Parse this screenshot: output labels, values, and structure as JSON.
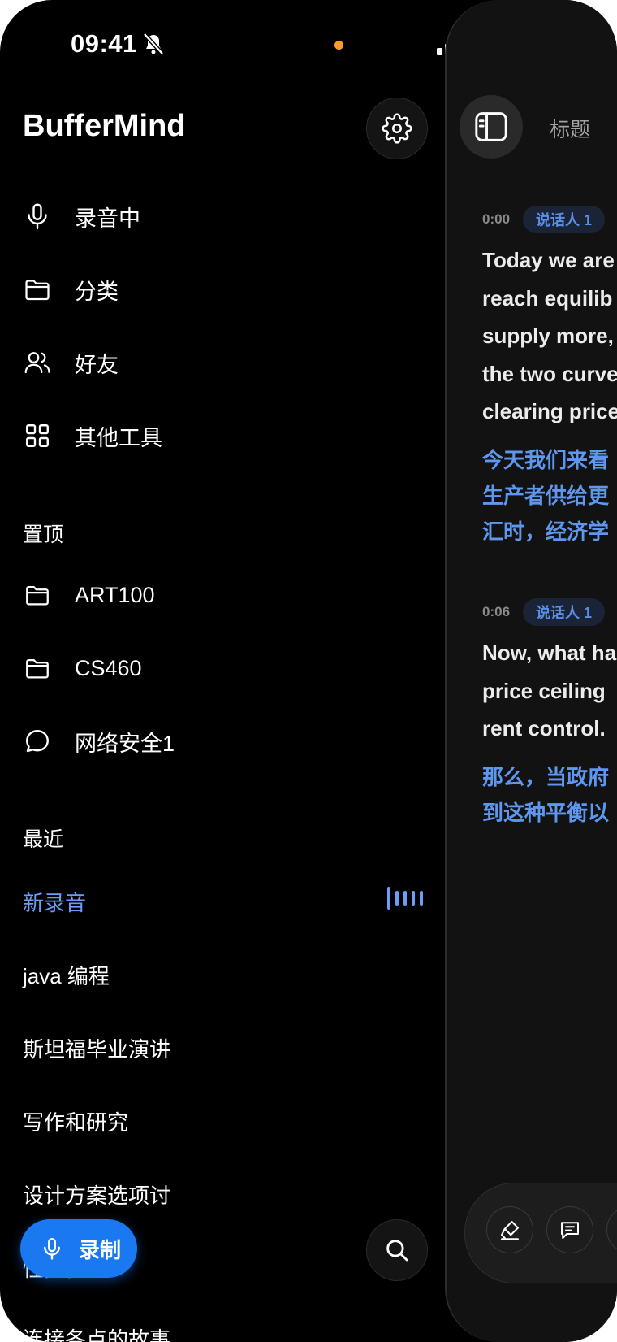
{
  "status_bar": {
    "time": "09:41"
  },
  "app": {
    "title": "BufferMind"
  },
  "nav": [
    {
      "label": "录音中",
      "icon": "microphone-icon"
    },
    {
      "label": "分类",
      "icon": "folder-icon"
    },
    {
      "label": "好友",
      "icon": "users-icon"
    },
    {
      "label": "其他工具",
      "icon": "grid-icon"
    }
  ],
  "pinned": {
    "header": "置顶",
    "items": [
      {
        "label": "ART100",
        "icon": "folder-icon"
      },
      {
        "label": "CS460",
        "icon": "folder-icon"
      },
      {
        "label": "网络安全1",
        "icon": "chat-bubble-icon"
      }
    ]
  },
  "recent": {
    "header": "最近",
    "items": [
      {
        "label": "新录音",
        "active": true
      },
      {
        "label": "java 编程"
      },
      {
        "label": "斯坦福毕业演讲"
      },
      {
        "label": "写作和研究"
      },
      {
        "label": "设计方案选项讨"
      },
      {
        "label": "性能优化"
      },
      {
        "label": "连接各点的故事"
      }
    ]
  },
  "record_button": {
    "label": "录制"
  },
  "panel": {
    "title": "标题",
    "segments": [
      {
        "time": "0:00",
        "speaker": "说话人 1",
        "text": "Today we are\nreach equilib\nsupply more,\nthe two curve\nclearing price",
        "translation": "今天我们来看\n生产者供给更\n汇时，经济学"
      },
      {
        "time": "0:06",
        "speaker": "说话人 1",
        "text": "Now, what ha\nprice ceiling\nrent control.",
        "translation": "那么，当政府\n到这种平衡以"
      }
    ]
  },
  "colors": {
    "accent": "#1a78f0",
    "active_text": "#6c9dfa",
    "translation": "#5e97ee"
  }
}
